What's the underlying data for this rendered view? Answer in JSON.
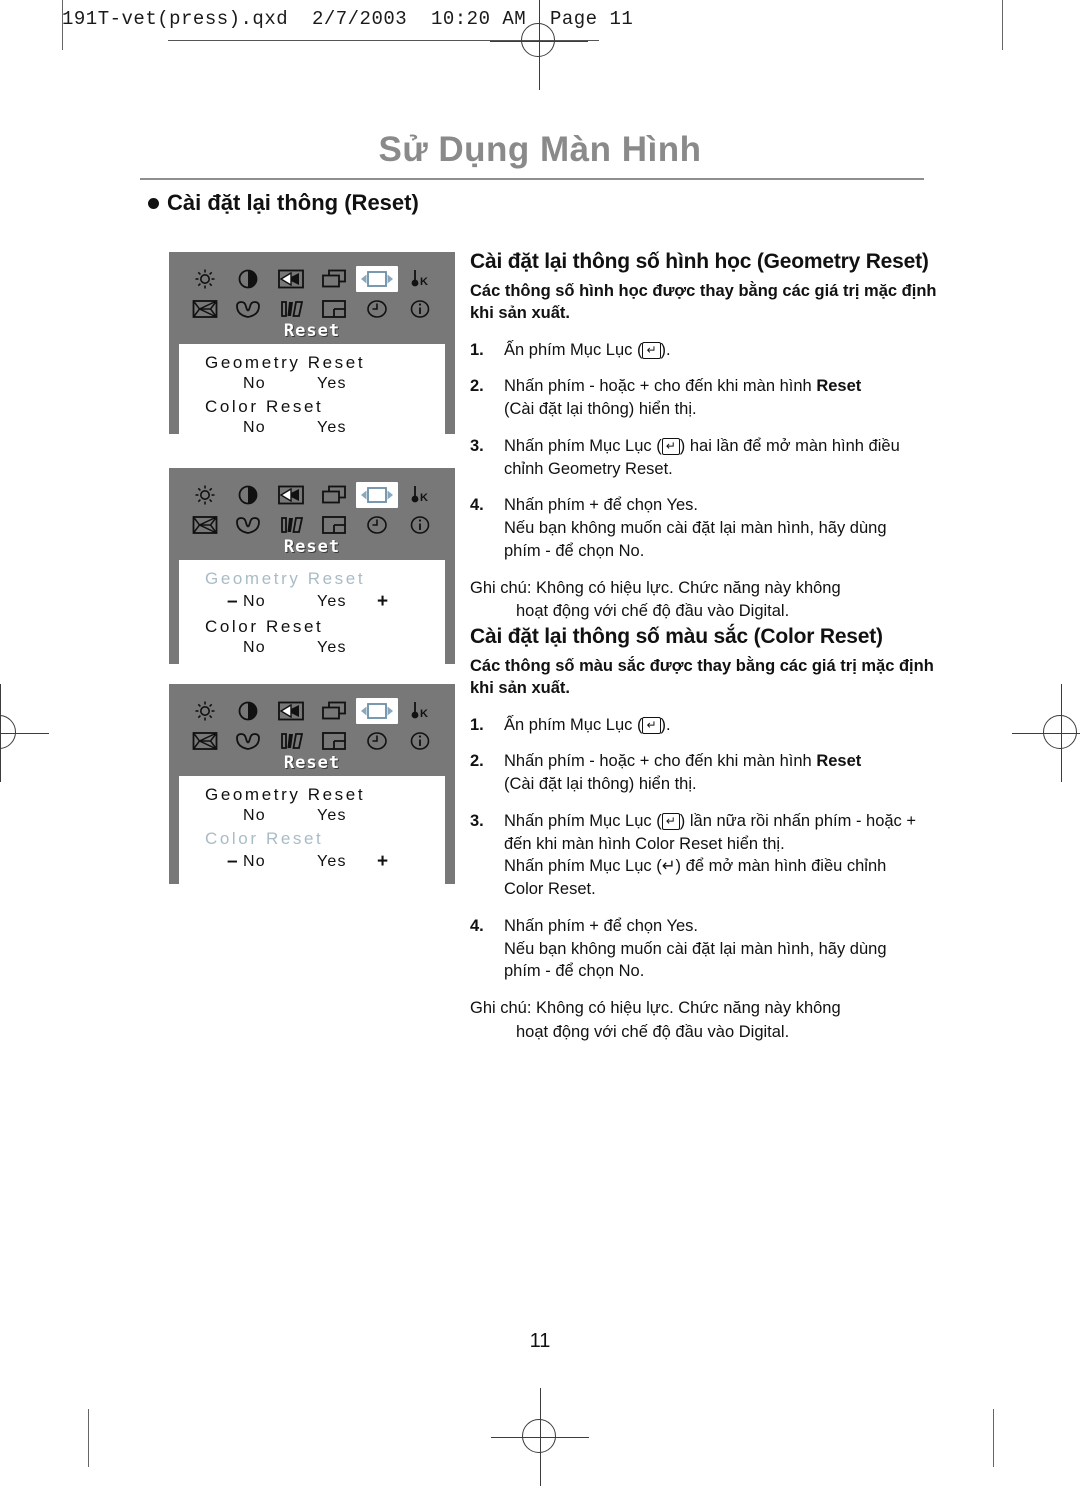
{
  "prepress": {
    "header_line": "191T-vet(press).qxd  2/7/2003  10:20 AM  Page 11"
  },
  "document": {
    "title": "Sử Dụng Màn Hình",
    "section_heading": "Cài đặt lại thông (Reset)",
    "page_number": "11"
  },
  "osd_panels": [
    {
      "id": "osd-default",
      "osd_label": "Reset",
      "selected_icon": "reset-icon",
      "icons_row1": [
        "brightness-icon",
        "contrast-icon",
        "image-lock-icon",
        "position-icon",
        "reset-icon",
        "color-temperature-icon"
      ],
      "icons_row2": [
        "pincushion-icon",
        "trapezoid-icon",
        "parallelogram-icon",
        "osd-position-icon",
        "clock-icon",
        "information-icon"
      ],
      "rows": [
        {
          "title": "Geometry Reset",
          "active": false,
          "minus": "",
          "no": "No",
          "yes": "Yes",
          "plus": ""
        },
        {
          "title": "Color Reset",
          "active": false,
          "minus": "",
          "no": "No",
          "yes": "Yes",
          "plus": ""
        }
      ]
    },
    {
      "id": "osd-geometry-selected",
      "osd_label": "Reset",
      "selected_icon": "reset-icon",
      "icons_row1": [
        "brightness-icon",
        "contrast-icon",
        "image-lock-icon",
        "position-icon",
        "reset-icon",
        "color-temperature-icon"
      ],
      "icons_row2": [
        "pincushion-icon",
        "trapezoid-icon",
        "parallelogram-icon",
        "osd-position-icon",
        "clock-icon",
        "information-icon"
      ],
      "rows": [
        {
          "title": "Geometry Reset",
          "active": true,
          "minus": "–",
          "no": "No",
          "yes": "Yes",
          "plus": "+"
        },
        {
          "title": "Color Reset",
          "active": false,
          "minus": "",
          "no": "No",
          "yes": "Yes",
          "plus": ""
        }
      ]
    },
    {
      "id": "osd-color-selected",
      "osd_label": "Reset",
      "selected_icon": "reset-icon",
      "icons_row1": [
        "brightness-icon",
        "contrast-icon",
        "image-lock-icon",
        "position-icon",
        "reset-icon",
        "color-temperature-icon"
      ],
      "icons_row2": [
        "pincushion-icon",
        "trapezoid-icon",
        "parallelogram-icon",
        "osd-position-icon",
        "clock-icon",
        "information-icon"
      ],
      "rows": [
        {
          "title": "Geometry Reset",
          "active": false,
          "minus": "",
          "no": "No",
          "yes": "Yes",
          "plus": ""
        },
        {
          "title": "Color Reset",
          "active": true,
          "minus": "–",
          "no": "No",
          "yes": "Yes",
          "plus": "+"
        }
      ]
    }
  ],
  "geometry_section": {
    "heading": "Cài đặt lại thông số hình học (Geometry Reset)",
    "intro": "Các thông số hình học được thay bằng các giá trị mặc định khi sản xuất.",
    "steps": [
      {
        "num": "1.",
        "line1_a": "Ấn phím Mục Lục (",
        "line1_b": ").",
        "key": "↵",
        "lines": []
      },
      {
        "num": "2.",
        "line1_a": "Nhấn phím - hoặc + cho đến khi màn hình ",
        "bold": "Reset",
        "lines": [
          "(Cài đặt lại thông) hiển thị."
        ]
      },
      {
        "num": "3.",
        "line1_a": "Nhấn phím Mục Lục (",
        "line1_b": ") hai lần để mở màn hình điều",
        "key": "↵",
        "lines": [
          "chỉnh Geometry Reset."
        ]
      },
      {
        "num": "4.",
        "line1_a": "Nhấn phím + để chọn Yes.",
        "lines": [
          "Nếu bạn không muốn cài đặt lại màn hình, hãy dùng",
          "phím - để chọn No."
        ]
      }
    ],
    "note_line1": "Ghi chú: Không có hiệu lực. Chức năng này không",
    "note_line2": "hoạt động với chế độ đầu vào Digital."
  },
  "color_section": {
    "heading": "Cài đặt lại thông số màu sắc (Color Reset)",
    "intro": "Các thông số màu sắc được thay bằng các giá trị mặc định khi sản xuất.",
    "steps": [
      {
        "num": "1.",
        "line1_a": "Ấn phím Mục Lục (",
        "line1_b": ").",
        "key": "↵",
        "lines": []
      },
      {
        "num": "2.",
        "line1_a": "Nhấn phím - hoặc + cho đến khi màn hình ",
        "bold": "Reset",
        "lines": [
          "(Cài đặt lại thông) hiển thị."
        ]
      },
      {
        "num": "3.",
        "line1_a": "Nhấn phím Mục Lục (",
        "line1_b": ") lần nữa rồi nhấn phím - hoặc +",
        "key": "↵",
        "lines": [
          "đến khi màn hình Color Reset hiển thị.",
          "Nhấn phím Mục Lục (↵) để mở màn hình điều chỉnh",
          "Color Reset."
        ]
      },
      {
        "num": "4.",
        "line1_a": "Nhấn phím + để chọn Yes.",
        "lines": [
          "Nếu bạn không muốn cài đặt lại màn hình, hãy dùng",
          "phím - để chọn No."
        ]
      }
    ],
    "note_line1": "Ghi chú: Không có hiệu lực. Chức năng này không",
    "note_line2": "hoạt động với chế độ đầu vào Digital."
  },
  "colors": {
    "osd_background": "#787878",
    "osd_menu_background": "#ffffff",
    "osd_active_text": "#a9bcc6",
    "title_gray": "#8a8a8a"
  }
}
